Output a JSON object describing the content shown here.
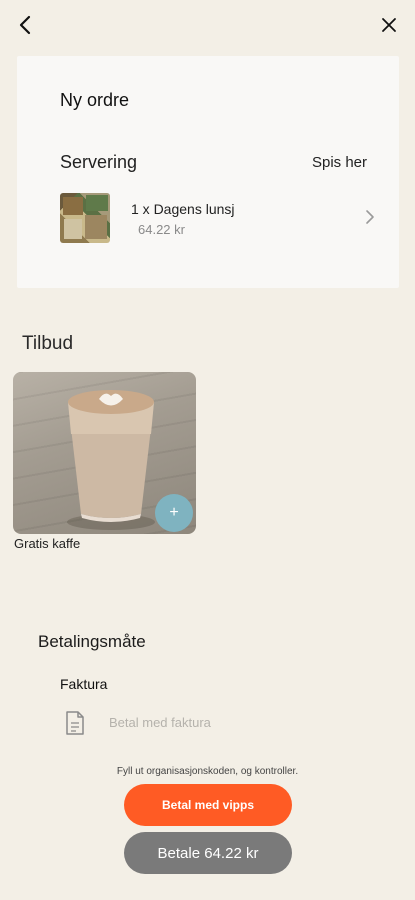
{
  "topbar": {
    "back_icon": "chevron-left-icon",
    "close_icon": "close-icon"
  },
  "order": {
    "title": "Ny ordre",
    "serving_label": "Servering",
    "serving_value": "Spis her",
    "item": {
      "name": "1 x Dagens lunsj",
      "price": "64.22 kr"
    }
  },
  "offers": {
    "heading": "Tilbud",
    "items": [
      {
        "label": "Gratis kaffe",
        "add_symbol": "+"
      }
    ]
  },
  "payment": {
    "heading": "Betalingsmåte",
    "invoice_label": "Faktura",
    "invoice_option": "Betal med faktura",
    "hint": "Fyll ut organisasjonskoden, og kontroller.",
    "vipps_button": "Betal med vipps",
    "pay_button": "Betale 64.22 kr"
  },
  "colors": {
    "background": "#f3efe6",
    "vipps": "#ff5b24",
    "pay_button": "#7a7a7a",
    "add_button": "#7fb3c0"
  }
}
